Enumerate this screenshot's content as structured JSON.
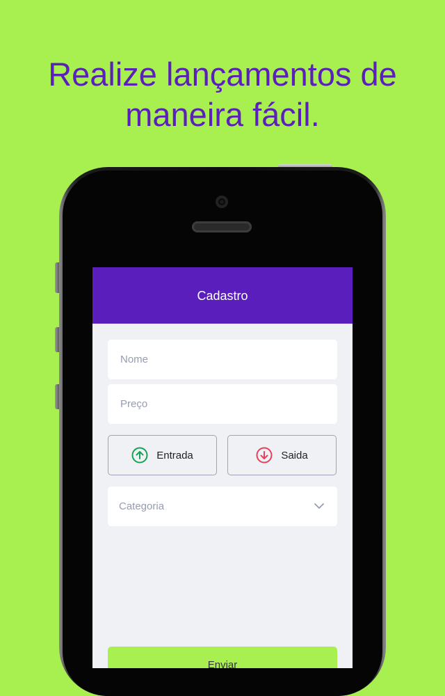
{
  "headline": {
    "line1": "Realize lançamentos de",
    "line2": "maneira fácil."
  },
  "app": {
    "title": "Cadastro",
    "form": {
      "name_placeholder": "Nome",
      "price_placeholder": "Preço",
      "income_label": "Entrada",
      "outcome_label": "Saida",
      "category_placeholder": "Categoria",
      "submit_label": "Enviar"
    }
  },
  "colors": {
    "background": "#a8f04f",
    "brand": "#5a1ebd",
    "income": "#12a454",
    "outcome": "#e83f5b"
  },
  "icons": {
    "income": "arrow-up-circle-icon",
    "outcome": "arrow-down-circle-icon",
    "select": "chevron-down-icon"
  }
}
